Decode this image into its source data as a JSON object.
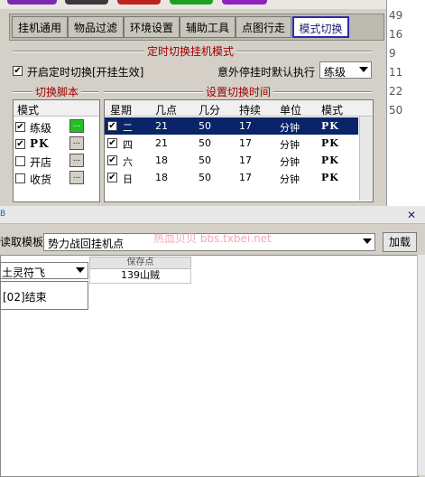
{
  "tabs": [
    "挂机通用",
    "物品过滤",
    "环境设置",
    "辅助工具",
    "点图行走",
    "模式切换"
  ],
  "active_tab": "模式切换",
  "timed_switch": {
    "section_title": "定时切换挂机模式",
    "enable_label": "开启定时切换[开挂生效]",
    "enable_checked": true,
    "default_label": "意外停挂时默认执行",
    "default_value": "练级"
  },
  "script_section_title": "切换脚本",
  "script_list": {
    "header": "模式",
    "items": [
      {
        "label": "练级",
        "checked": true
      },
      {
        "label": "PK",
        "checked": true
      },
      {
        "label": "开店",
        "checked": false
      },
      {
        "label": "收货",
        "checked": false
      }
    ],
    "button_label": "..."
  },
  "schedule_section_title": "设置切换时间",
  "schedule": {
    "headers": [
      "星期",
      "几点",
      "几分",
      "持续",
      "单位",
      "模式"
    ],
    "rows": [
      {
        "day": "二",
        "hour": "21",
        "minute": "50",
        "duration": "17",
        "unit": "分钟",
        "mode": "PK",
        "checked": true,
        "selected": true
      },
      {
        "day": "四",
        "hour": "21",
        "minute": "50",
        "duration": "17",
        "unit": "分钟",
        "mode": "PK",
        "checked": true,
        "selected": false
      },
      {
        "day": "六",
        "hour": "18",
        "minute": "50",
        "duration": "17",
        "unit": "分钟",
        "mode": "PK",
        "checked": true,
        "selected": false
      },
      {
        "day": "日",
        "hour": "18",
        "minute": "50",
        "duration": "17",
        "unit": "分钟",
        "mode": "PK",
        "checked": true,
        "selected": false
      }
    ]
  },
  "right_pane_numbers": [
    "49",
    "16",
    "9",
    "11",
    "22",
    "50"
  ],
  "bottom_window": {
    "app_glyph": "B",
    "close_label": "✕",
    "template_label": "读取模板",
    "template_value": "势力战回挂机点",
    "watermark": "热血贝贝 bbs.txbei.net",
    "load_button": "加载",
    "left_combo_value": "土灵符飞",
    "end_label": "[02]结束",
    "save_header": "保存点",
    "save_value": "139山贼"
  },
  "colors": {
    "active_tab_border": "#2a2ab0",
    "section_title": "#a00000",
    "selected_row": "#0a246a",
    "green_button": "#22c022"
  }
}
